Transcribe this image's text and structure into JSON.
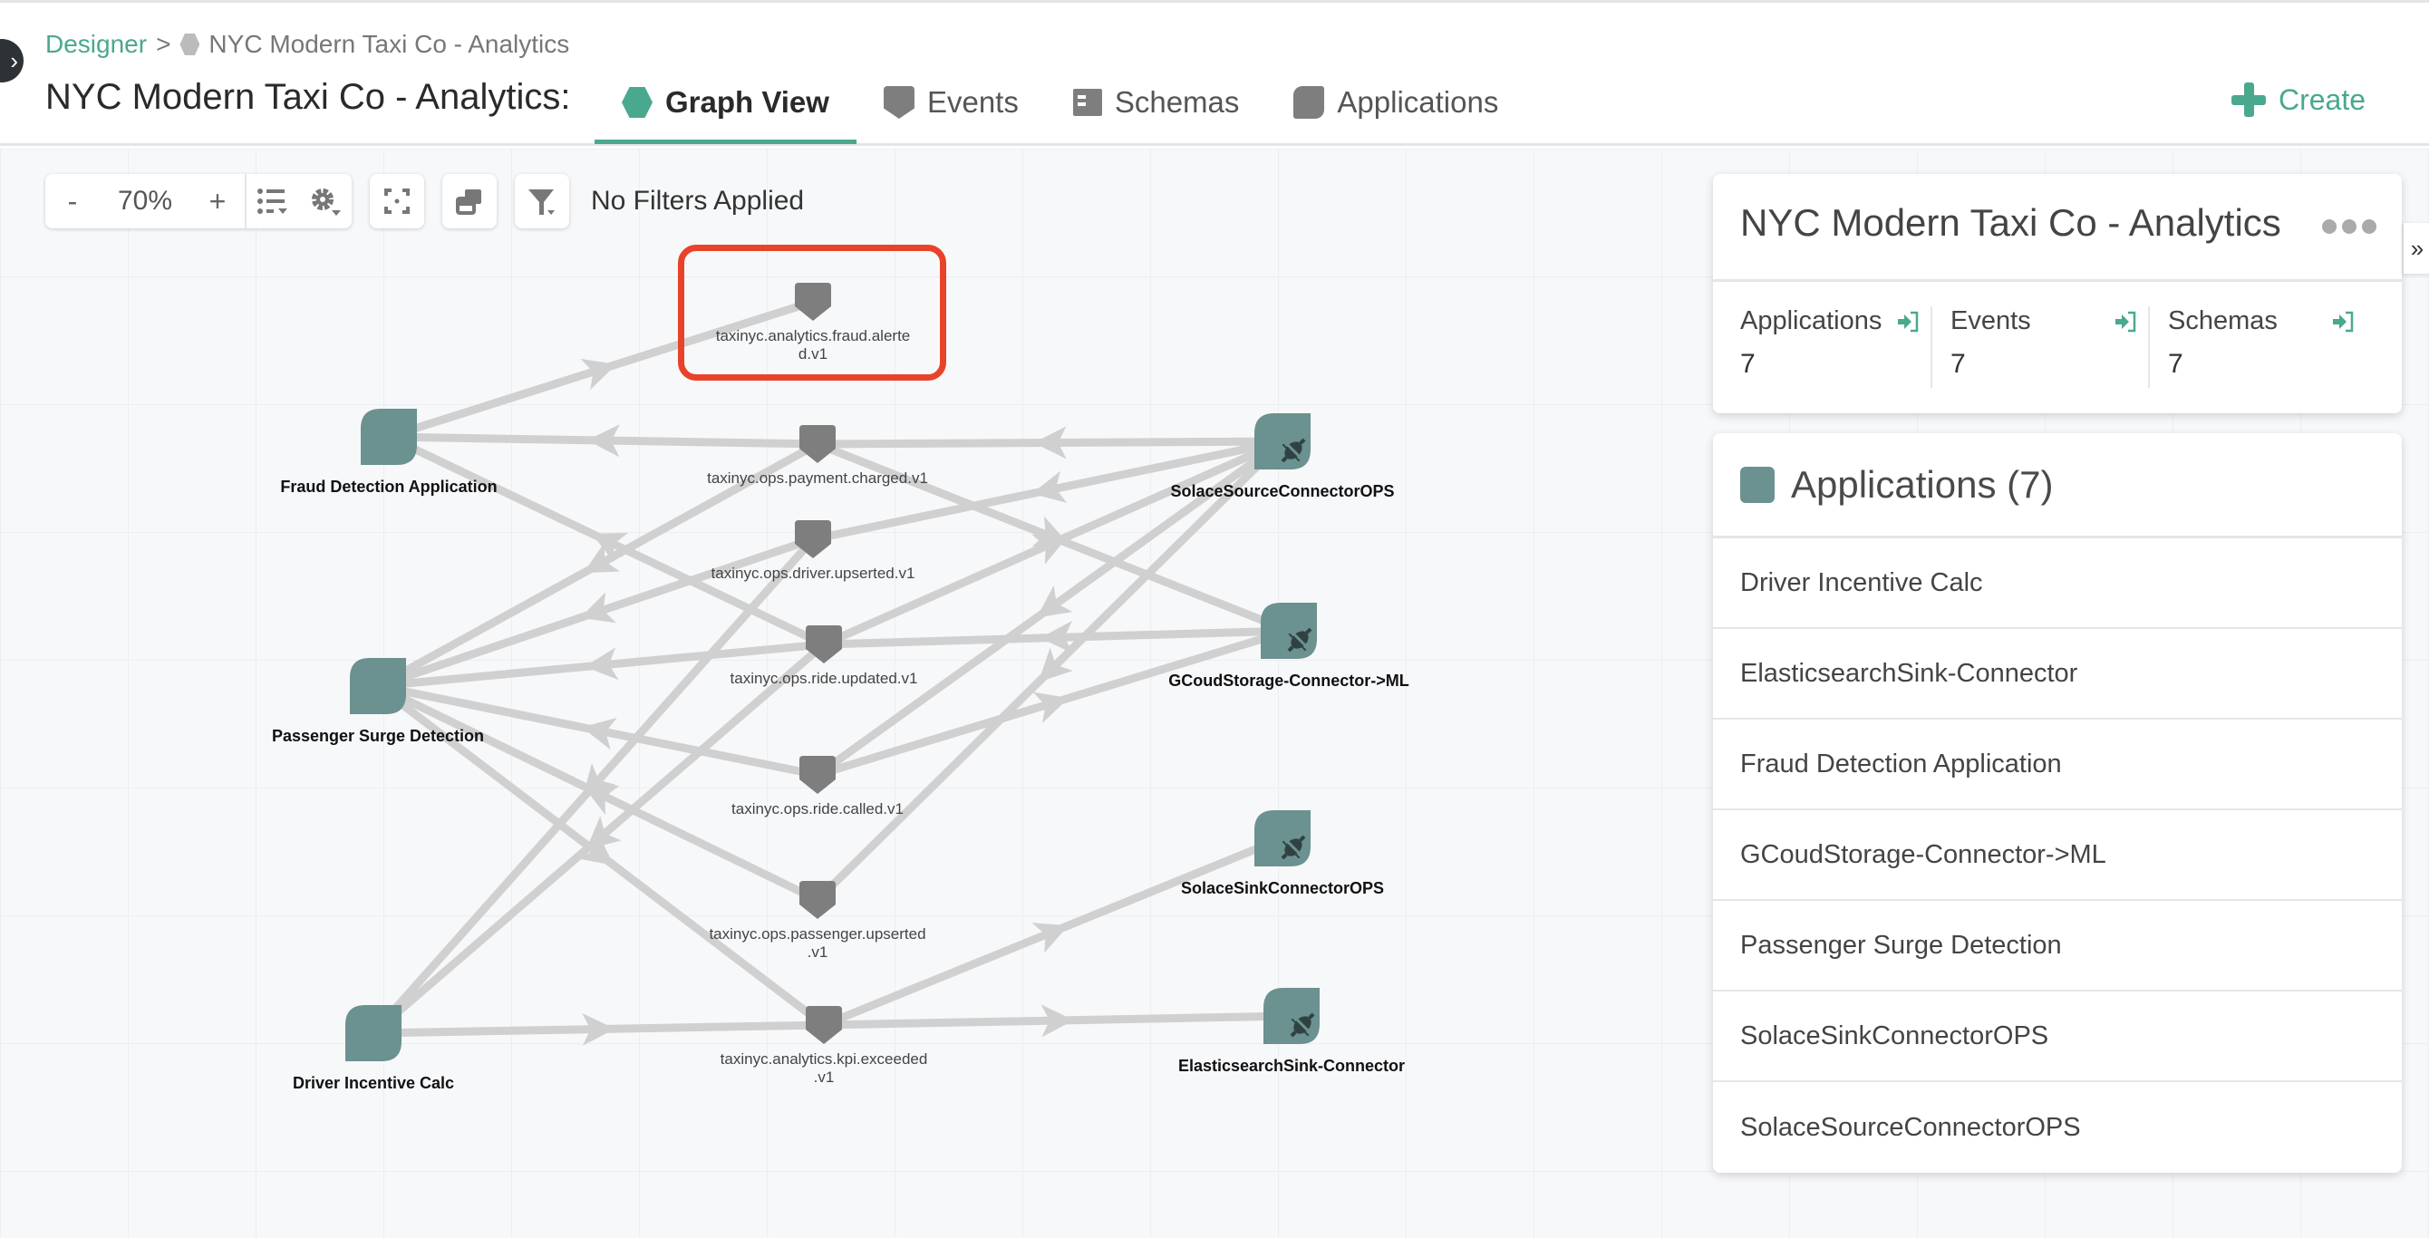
{
  "header": {
    "breadcrumb": {
      "root": "Designer",
      "separator": ">",
      "current": "NYC Modern Taxi Co - Analytics"
    },
    "title": "NYC Modern Taxi Co - Analytics:",
    "tabs": [
      {
        "label": "Graph View",
        "icon": "hexagon-icon",
        "active": true
      },
      {
        "label": "Events",
        "icon": "event-icon",
        "active": false
      },
      {
        "label": "Schemas",
        "icon": "schema-icon",
        "active": false
      },
      {
        "label": "Applications",
        "icon": "application-icon",
        "active": false
      }
    ],
    "create_label": "Create"
  },
  "toolbar": {
    "zoom_out": "-",
    "zoom_level": "70%",
    "zoom_in": "+",
    "filter_status": "No Filters Applied"
  },
  "graph": {
    "applications": [
      {
        "id": "fraud",
        "label": "Fraud Detection Application",
        "type": "application"
      },
      {
        "id": "surge",
        "label": "Passenger Surge Detection",
        "type": "application"
      },
      {
        "id": "driver",
        "label": "Driver Incentive Calc",
        "type": "application"
      },
      {
        "id": "src",
        "label": "SolaceSourceConnectorOPS",
        "type": "connector"
      },
      {
        "id": "gcs",
        "label": "GCoudStorage-Connector->ML",
        "type": "connector"
      },
      {
        "id": "sink",
        "label": "SolaceSinkConnectorOPS",
        "type": "connector"
      },
      {
        "id": "es",
        "label": "ElasticsearchSink-Connector",
        "type": "connector"
      }
    ],
    "events": [
      {
        "id": "fraudalert",
        "label": [
          "taxinyc.analytics.fraud.alerte",
          "d.v1"
        ],
        "highlighted": true
      },
      {
        "id": "payment",
        "label": [
          "taxinyc.ops.payment.charged.v1"
        ]
      },
      {
        "id": "driverup",
        "label": [
          "taxinyc.ops.driver.upserted.v1"
        ]
      },
      {
        "id": "rideup",
        "label": [
          "taxinyc.ops.ride.updated.v1"
        ]
      },
      {
        "id": "ridecalled",
        "label": [
          "taxinyc.ops.ride.called.v1"
        ]
      },
      {
        "id": "passup",
        "label": [
          "taxinyc.ops.passenger.upserted",
          ".v1"
        ]
      },
      {
        "id": "kpi",
        "label": [
          "taxinyc.analytics.kpi.exceeded",
          ".v1"
        ]
      }
    ],
    "edges": [
      {
        "from": "fraud",
        "to": "fraudalert"
      },
      {
        "from": "payment",
        "to": "fraud"
      },
      {
        "from": "rideup",
        "to": "fraud"
      },
      {
        "from": "src",
        "to": "payment"
      },
      {
        "from": "src",
        "to": "driverup"
      },
      {
        "from": "src",
        "to": "ridecalled"
      },
      {
        "from": "src",
        "to": "passup"
      },
      {
        "from": "payment",
        "to": "gcs"
      },
      {
        "from": "gcs",
        "to": "rideup"
      },
      {
        "from": "ridecalled",
        "to": "gcs"
      },
      {
        "from": "rideup",
        "to": "src"
      },
      {
        "from": "payment",
        "to": "surge"
      },
      {
        "from": "driverup",
        "to": "surge"
      },
      {
        "from": "rideup",
        "to": "surge"
      },
      {
        "from": "ridecalled",
        "to": "surge"
      },
      {
        "from": "passup",
        "to": "surge"
      },
      {
        "from": "surge",
        "to": "kpi"
      },
      {
        "from": "driverup",
        "to": "driver"
      },
      {
        "from": "rideup",
        "to": "driver"
      },
      {
        "from": "driver",
        "to": "kpi"
      },
      {
        "from": "kpi",
        "to": "sink"
      },
      {
        "from": "kpi",
        "to": "es"
      }
    ]
  },
  "summary": {
    "title": "NYC Modern Taxi Co - Analytics",
    "stats": [
      {
        "label": "Applications",
        "value": "7"
      },
      {
        "label": "Events",
        "value": "7"
      },
      {
        "label": "Schemas",
        "value": "7"
      }
    ]
  },
  "applications_panel": {
    "title": "Applications (7)",
    "items": [
      "Driver Incentive Calc",
      "ElasticsearchSink-Connector",
      "Fraud Detection Application",
      "GCoudStorage-Connector->ML",
      "Passenger Surge Detection",
      "SolaceSinkConnectorOPS",
      "SolaceSourceConnectorOPS"
    ]
  },
  "colors": {
    "accent": "#4aa88f",
    "app_node": "#6b9190",
    "event_node": "#7e7e7e",
    "edge": "#d0d0d0",
    "highlight": "#e8432a"
  }
}
